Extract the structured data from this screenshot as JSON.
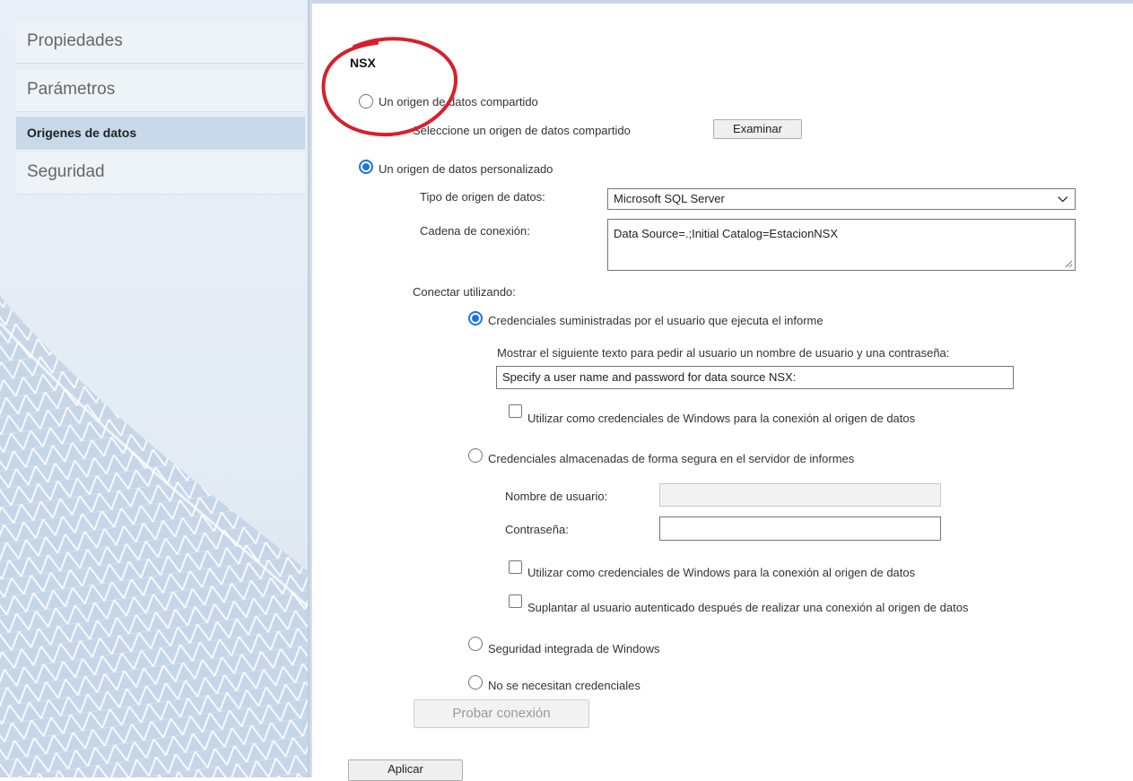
{
  "sidebar": {
    "items": [
      {
        "label": "Propiedades"
      },
      {
        "label": "Parámetros"
      },
      {
        "label": "Origenes de datos"
      },
      {
        "label": "Seguridad"
      }
    ]
  },
  "form": {
    "title": "NSX",
    "shared": {
      "radio_label": "Un origen de datos compartido",
      "select_prompt": "Seleccione un origen de datos compartido",
      "browse_button": "Examinar"
    },
    "custom": {
      "radio_label": "Un origen de datos personalizado",
      "type_label": "Tipo de origen de datos:",
      "type_value": "Microsoft SQL Server",
      "connection_label": "Cadena de conexión:",
      "connection_value": "Data Source=.;Initial Catalog=EstacionNSX"
    },
    "connect_using": {
      "label": "Conectar utilizando:",
      "user_supplied": {
        "radio_label": "Credenciales suministradas por el usuario que ejecuta el informe",
        "prompt_label": "Mostrar el siguiente texto para pedir al usuario un nombre de usuario y una contraseña:",
        "prompt_value": "Specify a user name and password for data source NSX:",
        "windows_checkbox": "Utilizar como credenciales de Windows para la conexión al origen de datos"
      },
      "stored": {
        "radio_label": "Credenciales almacenadas de forma segura en el servidor de informes",
        "username_label": "Nombre de usuario:",
        "username_value": "",
        "password_label": "Contraseña:",
        "password_value": "",
        "windows_checkbox": "Utilizar como credenciales de Windows para la conexión al origen de datos",
        "impersonate_checkbox": "Suplantar al usuario autenticado después de realizar una conexión al origen de datos"
      },
      "integrated": {
        "radio_label": "Seguridad integrada de Windows"
      },
      "none": {
        "radio_label": "No se necesitan credenciales"
      }
    },
    "test_button": "Probar conexión",
    "apply_button": "Aplicar"
  },
  "colors": {
    "accent": "#1a73e8",
    "annotation": "#d8202a",
    "sidebar_active": "#c8d9ea"
  }
}
